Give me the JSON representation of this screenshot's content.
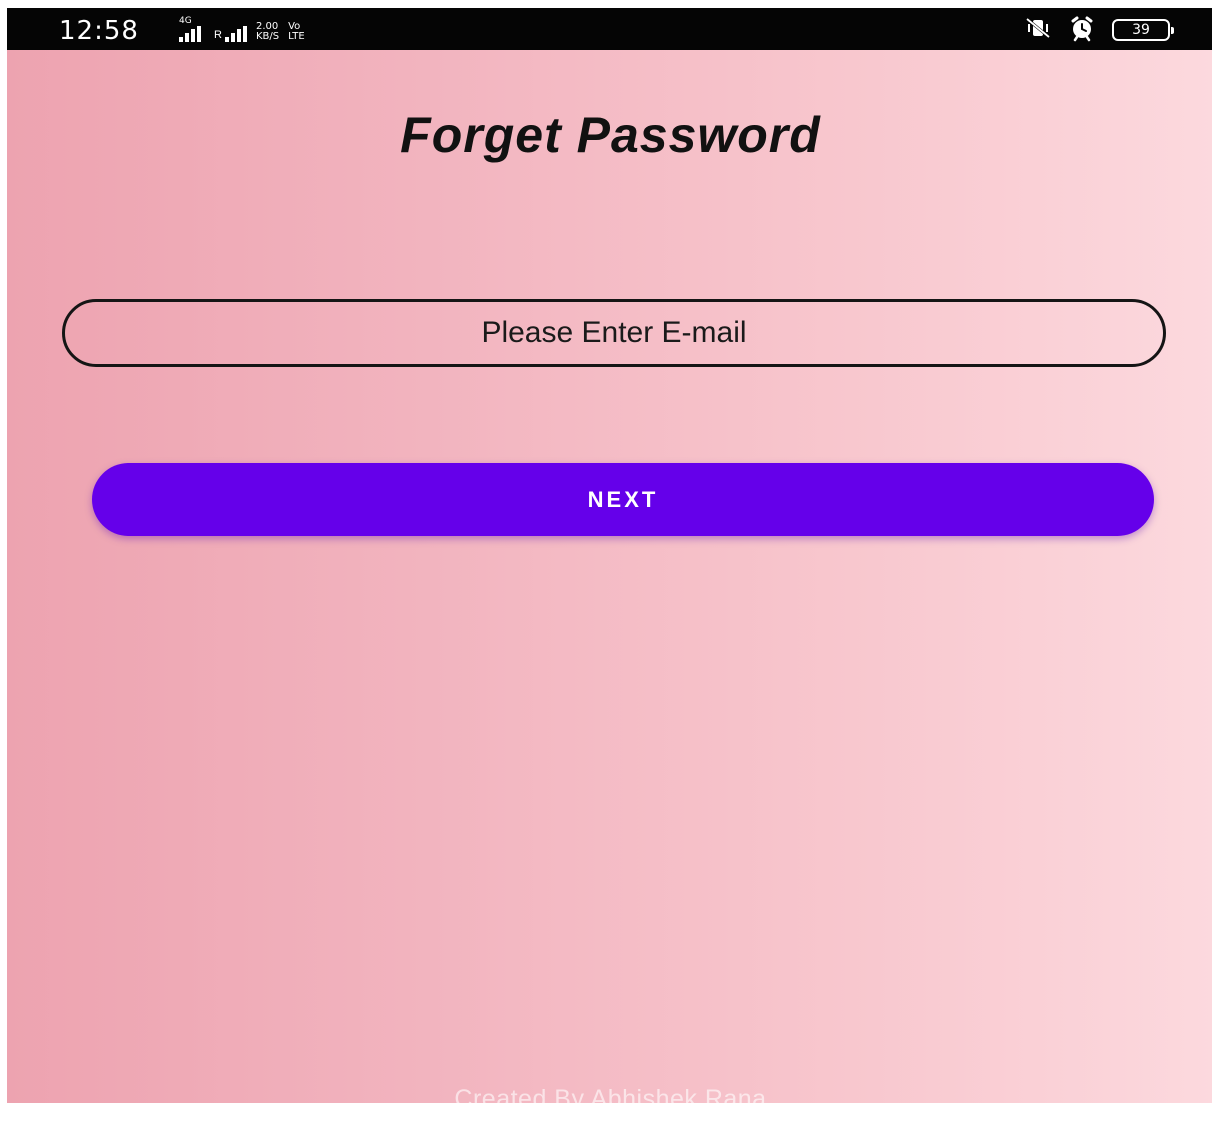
{
  "status_bar": {
    "time": "12:58",
    "network_type": "4G",
    "roaming_label": "R",
    "speed_value": "2.00",
    "speed_unit": "KB/S",
    "volte_top": "Vo",
    "volte_bottom": "LTE",
    "battery_level": "39",
    "icons": [
      "signal-icon",
      "signal-icon",
      "vibrate-icon",
      "alarm-icon",
      "battery-icon"
    ]
  },
  "screen": {
    "title": "Forget Password",
    "email_placeholder": "Please Enter E-mail",
    "next_button_label": "NEXT",
    "footer_credit": "Created By Abhishek Rana"
  },
  "colors": {
    "status_bar_background": "#050505",
    "gradient_left": "#eda3b0",
    "gradient_right": "#fcd9de",
    "button_background": "#6500ea",
    "button_text": "#ffffff",
    "title_text": "#111111",
    "input_border": "#151515"
  }
}
